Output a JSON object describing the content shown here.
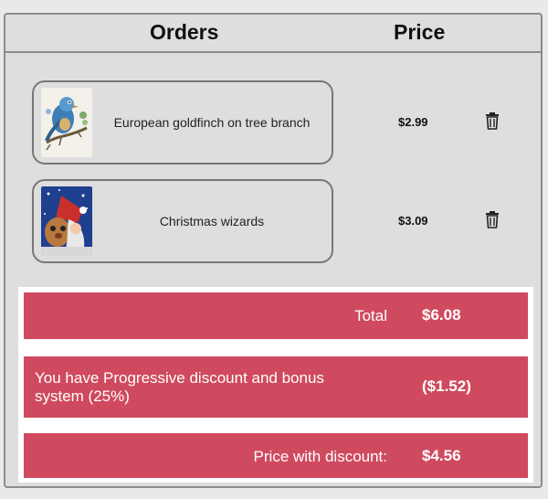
{
  "header": {
    "orders_label": "Orders",
    "price_label": "Price"
  },
  "orders": [
    {
      "name": "European goldfinch on tree branch",
      "price": "$2.99",
      "thumb_icon": "bird-painting-thumbnail",
      "delete_icon": "trash-icon"
    },
    {
      "name": "Christmas wizards",
      "price": "$3.09",
      "thumb_icon": "christmas-wizard-thumbnail",
      "delete_icon": "trash-icon"
    }
  ],
  "summary": {
    "total_label": "Total",
    "total_value": "$6.08",
    "discount_label": "You have Progressive discount and bonus system (25%)",
    "discount_value": "($1.52)",
    "final_label": "Price with discount:",
    "final_value": "$4.56"
  },
  "colors": {
    "accent": "#cf4a5e",
    "background": "#dedede",
    "border": "#8c8c8c"
  }
}
